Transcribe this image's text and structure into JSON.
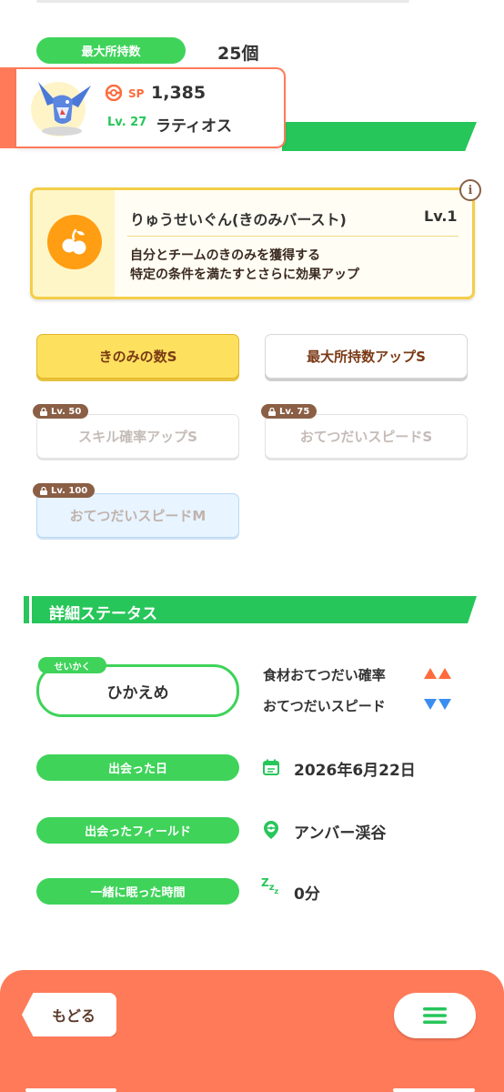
{
  "max_storage": {
    "label": "最大所持数",
    "value": "25個"
  },
  "pokemon": {
    "sp_label": "SP",
    "sp_value": "1,385",
    "level": "Lv. 27",
    "name": "ラティオス"
  },
  "skill": {
    "name": "りゅうせいぐん(きのみバースト)",
    "level": "Lv.1",
    "desc_line1": "自分とチームのきのみを獲得する",
    "desc_line2": "特定の条件を満たすとさらに効果アップ"
  },
  "upgrades": [
    {
      "label": "きのみの数S",
      "locked": false
    },
    {
      "label": "最大所持数アップS",
      "locked": false
    },
    {
      "label": "スキル確率アップS",
      "lock_level": "Lv. 50"
    },
    {
      "label": "おてつだいスピードS",
      "lock_level": "Lv. 75"
    },
    {
      "label": "おてつだいスピードM",
      "lock_level": "Lv. 100"
    }
  ],
  "details": {
    "title": "詳細ステータス",
    "nature_tag": "せいかく",
    "nature": "ひかえめ",
    "nature_up": "食材おてつだい確率",
    "nature_down": "おてつだいスピード",
    "met_date_label": "出会った日",
    "met_date": "2026年6月22日",
    "met_field_label": "出会ったフィールド",
    "met_field": "アンバー渓谷",
    "sleep_label": "一緒に眠った時間",
    "sleep_value": "0分"
  },
  "footer": {
    "back_label": "もどる"
  },
  "colors": {
    "green": "#3fd35a",
    "orange": "#ff7a59",
    "gold": "#f4ce48"
  }
}
